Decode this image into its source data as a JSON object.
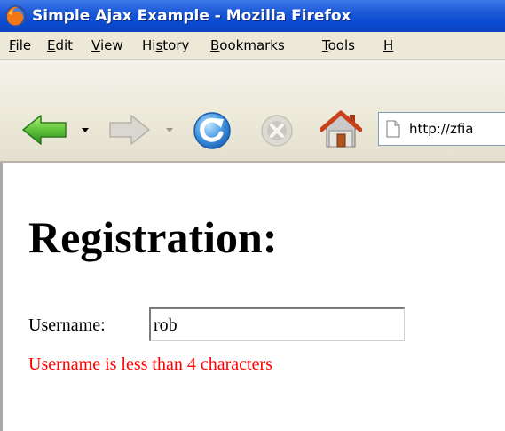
{
  "window": {
    "title": "Simple Ajax Example - Mozilla Firefox",
    "app_icon": "firefox-logo-icon"
  },
  "menubar": {
    "items": [
      {
        "mnemonic": "F",
        "rest": "ile"
      },
      {
        "mnemonic": "E",
        "rest": "dit"
      },
      {
        "mnemonic": "V",
        "rest": "iew"
      },
      {
        "pre": "Hi",
        "mnemonic": "s",
        "rest": "tory"
      },
      {
        "mnemonic": "B",
        "rest": "ookmarks"
      },
      {
        "mnemonic": "T",
        "rest": "ools"
      },
      {
        "mnemonic": "H",
        "rest": ""
      }
    ]
  },
  "toolbar": {
    "buttons": [
      "back-icon",
      "forward-icon",
      "reload-icon",
      "stop-icon",
      "home-icon"
    ],
    "url": "http://zfia"
  },
  "page": {
    "heading": "Registration:",
    "username_label": "Username:",
    "username_value": "rob",
    "error_message": "Username is less than 4 characters"
  },
  "colors": {
    "titlebar": "#0a4ad0",
    "chrome": "#ece9d8",
    "error": "#ff0000"
  }
}
